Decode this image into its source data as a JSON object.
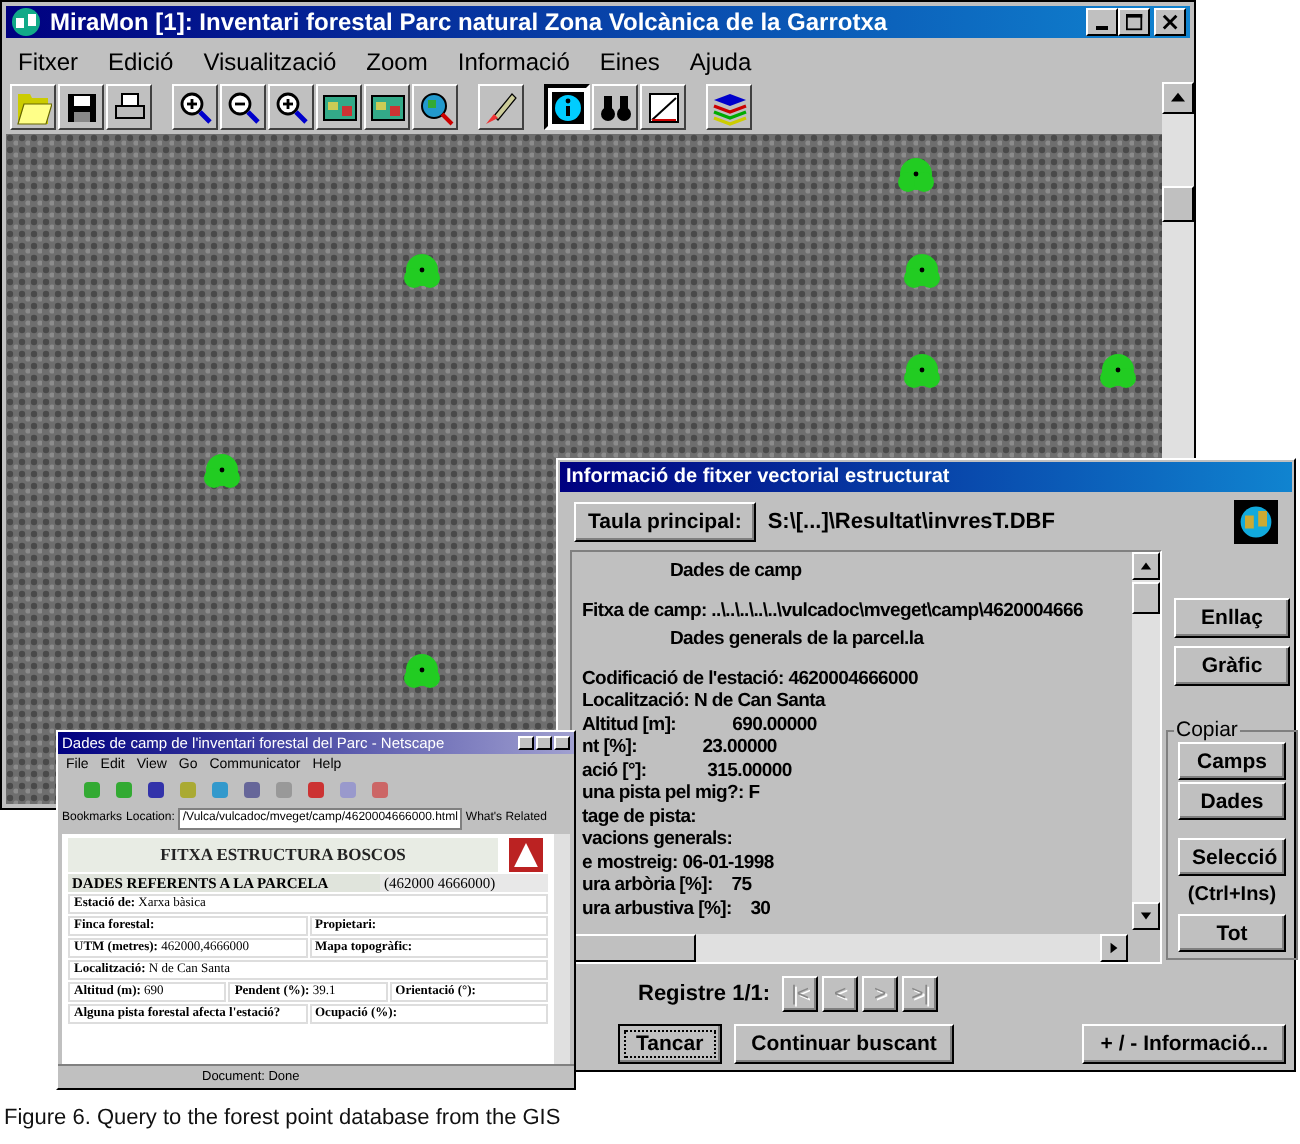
{
  "main_window": {
    "title": "MiraMon [1]:  Inventari forestal Parc natural Zona Volcànica de la Garrotxa",
    "menu": [
      "Fitxer",
      "Edició",
      "Visualització",
      "Zoom",
      "Informació",
      "Eines",
      "Ajuda"
    ],
    "toolbar": [
      {
        "kind": "open",
        "selected": false
      },
      {
        "kind": "save",
        "selected": false
      },
      {
        "kind": "print",
        "selected": false
      },
      {
        "kind": "zoom-in",
        "selected": false
      },
      {
        "kind": "zoom-out",
        "selected": false
      },
      {
        "kind": "zoom-window",
        "selected": false
      },
      {
        "kind": "map",
        "selected": false
      },
      {
        "kind": "map",
        "selected": false
      },
      {
        "kind": "globe",
        "selected": false
      },
      {
        "kind": "brush",
        "selected": false
      },
      {
        "kind": "info",
        "selected": true
      },
      {
        "kind": "binoculars",
        "selected": false
      },
      {
        "kind": "measure",
        "selected": false
      },
      {
        "kind": "layers",
        "selected": false
      }
    ]
  },
  "info_dialog": {
    "title": "Informació de fitxer vectorial estructurat",
    "table_button": "Taula principal:",
    "path": "S:\\[...]\\Resultat\\invresT.DBF",
    "lines": [
      {
        "kind": "heading",
        "text": "Dades de camp"
      },
      {
        "kind": "line",
        "text": "Fitxa de camp: ..\\..\\..\\..\\..\\vulcadoc\\mveget\\camp\\4620004666"
      },
      {
        "kind": "heading",
        "text": "Dades generals de la parcel.la"
      },
      {
        "kind": "line",
        "text": "Codificació de l'estació: 4620004666000"
      },
      {
        "kind": "line",
        "text": "Localització: N de Can Santa"
      },
      {
        "kind": "line",
        "text": "Altitud [m]:            690.00000"
      },
      {
        "kind": "line",
        "text": "nt [%]:              23.00000"
      },
      {
        "kind": "line",
        "text": "ació [°]:             315.00000"
      },
      {
        "kind": "line",
        "text": "una pista pel mig?: F"
      },
      {
        "kind": "line",
        "text": "tage de pista:"
      },
      {
        "kind": "line",
        "text": "vacions generals:"
      },
      {
        "kind": "line",
        "text": "e mostreig: 06-01-1998"
      },
      {
        "kind": "line",
        "text": "ura arbòria [%]:    75"
      },
      {
        "kind": "line",
        "text": "ura arbustiva [%]:    30"
      }
    ],
    "side_buttons": [
      "Enllaç",
      "Gràfic"
    ],
    "copy_group": {
      "label": "Copiar",
      "buttons": [
        "Camps",
        "Dades"
      ],
      "selection_button": "Selecció",
      "shortcut": "(Ctrl+Ins)",
      "all_button": "Tot"
    },
    "record": {
      "label": "Registre 1/1:",
      "nav": [
        {
          "label": "|<",
          "disabled": true
        },
        {
          "label": "<",
          "disabled": true
        },
        {
          "label": ">",
          "disabled": true
        },
        {
          "label": ">|",
          "disabled": true
        }
      ]
    },
    "bottom_buttons": [
      {
        "label": "Tancar",
        "focused": true
      },
      {
        "label": "Continuar buscant",
        "focused": false
      },
      {
        "label": "+ / - Informació...",
        "focused": false
      }
    ]
  },
  "browser": {
    "title": "Dades de camp de l'inventari forestal del Parc - Netscape",
    "menu": [
      "File",
      "Edit",
      "View",
      "Go",
      "Communicator",
      "Help"
    ],
    "bookmarks": "Bookmarks",
    "location_label": "Location:",
    "url": "/Vulca/vulcadoc/mveget/camp/4620004666000.html",
    "related": "What's Related",
    "page": {
      "heading": "FITXA ESTRUCTURA BOSCOS",
      "section": "DADES REFERENTS A LA PARCELA",
      "coords": "(462000 4666000)",
      "rows": [
        [
          "**Estació de:** Xarxa bàsica"
        ],
        [
          "**Finca forestal:**",
          "**Propietari:**"
        ],
        [
          "**UTM (metres):** 462000,4666000",
          "**Mapa topogràfic:**"
        ],
        [
          "**Localització:** N de Can Santa"
        ],
        [
          "**Altitud (m):** 690",
          "**Pendent (%):** 39.1",
          "**Orientació (°):**"
        ],
        [
          "**Alguna pista forestal afecta l'estació?**",
          "**Ocupació (%):**"
        ]
      ]
    },
    "status": "Document: Done"
  },
  "caption": "Figure 6. Query to the forest point database from the GIS"
}
